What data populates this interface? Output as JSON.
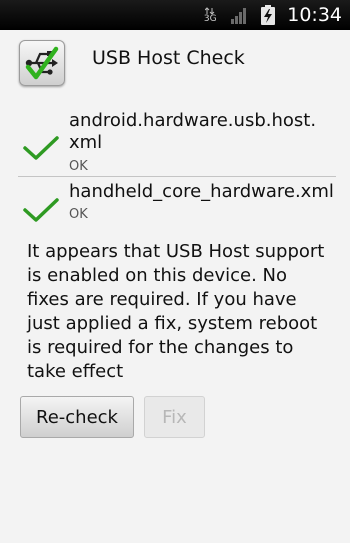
{
  "status_bar": {
    "network_label": "3G",
    "time": "10:34",
    "icons": [
      "network-3g-icon",
      "signal-icon",
      "battery-charging-icon"
    ]
  },
  "app": {
    "title": "USB Host Check",
    "icon": "usb-check-icon"
  },
  "checks": [
    {
      "name": "android.hardware.usb.host.\nxml",
      "status": "OK",
      "icon": "checkmark-icon"
    },
    {
      "name": "handheld_core_hardware.xml",
      "status": "OK",
      "icon": "checkmark-icon"
    }
  ],
  "message": "It appears that USB Host support is enabled on this device. No fixes are required. If you have just applied a fix, system reboot is required for the changes to take effect",
  "buttons": {
    "recheck_label": "Re-check",
    "fix_label": "Fix"
  },
  "colors": {
    "check_green": "#2e9a22",
    "background": "#f3f3f3",
    "status_bar": "#000000"
  }
}
